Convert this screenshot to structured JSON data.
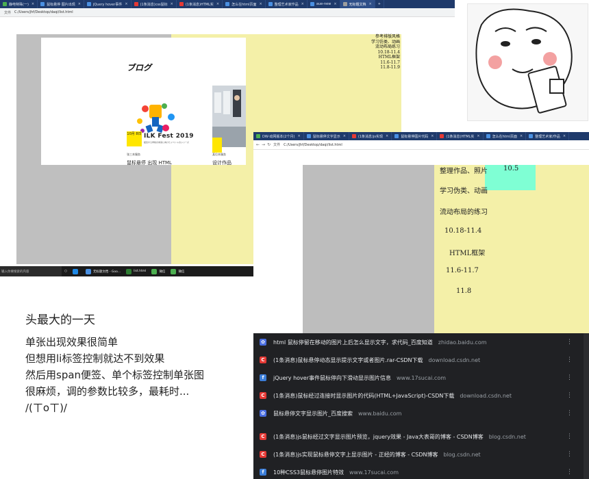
{
  "browser1": {
    "tabs": [
      {
        "label": "静电特殊(一)",
        "color": "#4caf50",
        "active": false
      },
      {
        "label": "鼠标悬停 图片出现",
        "color": "#4a90e2",
        "active": false
      },
      {
        "label": "jQuery hover事件",
        "color": "#4a90e2",
        "active": false
      },
      {
        "label": "(1条消息)css鼠标",
        "color": "#e53935",
        "active": false
      },
      {
        "label": "(1条消息)HTML实",
        "color": "#e53935",
        "active": false
      },
      {
        "label": "怎么在html页面",
        "color": "#4a90e2",
        "active": false
      },
      {
        "label": "整理艺术家作品",
        "color": "#4a90e2",
        "active": false
      },
      {
        "label": "aue-new",
        "color": "#4a90e2",
        "active": false
      },
      {
        "label": "无标题文档",
        "color": "#9e9e9e",
        "active": true
      }
    ],
    "address_label": "文件",
    "address": "C:/Users/jhf/Desktop/daqi/list.html",
    "nav_items": [
      "参考排版风格",
      "学习仿类、动画",
      "流动布局练习",
      "10.18-11.4",
      "HTML框架",
      "11.6-11.7",
      "11.8-11.9"
    ],
    "blog_title": "ブログ",
    "fest_date": "10月 8日",
    "fest_title": "ILK Fest 2019",
    "fest_sub": "結合する学校の未来に向けたイベントのシリーズ",
    "card1_caption": "张三本服务",
    "card1_title": "鼠标悬停 出现 HTML",
    "card2_caption": "某位本服务",
    "card2_title": "设计作品"
  },
  "taskbar": {
    "search_placeholder": "输入你要搜索的内容",
    "items": [
      {
        "label": "无标题文档 - Goo...",
        "color": "#4a90e2"
      },
      {
        "label": "list.html",
        "color": "#2e7d32"
      },
      {
        "label": "微信",
        "color": "#4caf50"
      },
      {
        "label": "微信",
        "color": "#4caf50"
      }
    ]
  },
  "browser2": {
    "tabs": [
      {
        "label": "DW-动网版本(2个月)",
        "color": "#4caf50"
      },
      {
        "label": "鼠标悬停文字显示",
        "color": "#4a90e2"
      },
      {
        "label": "(1条消息)js实现",
        "color": "#e53935"
      },
      {
        "label": "鼠标悬停图片代码",
        "color": "#4a90e2"
      },
      {
        "label": "(1条消息)HTML实",
        "color": "#e53935"
      },
      {
        "label": "怎么在html页面",
        "color": "#4a90e2"
      },
      {
        "label": "整理艺术家/作品",
        "color": "#4a90e2"
      }
    ],
    "address_label": "文件",
    "address": "C:/Users/jhf/Desktop/daqi/list.html",
    "nav_items": [
      "整理作品、照片",
      "10.5",
      "学习伪类、动画",
      "流动布局的练习",
      "10.18-11.4",
      "HTML框架",
      "11.6-11.7",
      "11.8"
    ]
  },
  "suggestions": [
    {
      "title": "html 鼠标停留在移动的图片上后怎么显示文字，求代码_百度知道",
      "domain": "zhidao.baidu.com",
      "icon": "paw",
      "color": "#4a6ee0"
    },
    {
      "title": "(1条消息)鼠标悬停动态显示提示文字或者图片.rar-CSDN下载",
      "domain": "download.csdn.net",
      "icon": "C",
      "color": "#e53935"
    },
    {
      "title": "jQuery hover事件鼠标停向下滑动显示图片信息",
      "domain": "www.17sucai.com",
      "icon": "f",
      "color": "#3b7dd8"
    },
    {
      "title": "(1条消息)鼠标经过连接时显示图片的代码(HTML+JavaScript)-CSDN下载",
      "domain": "download.csdn.net",
      "icon": "C",
      "color": "#e53935"
    },
    {
      "title": "鼠标悬停文字显示图片_百度搜索",
      "domain": "www.baidu.com",
      "icon": "paw",
      "color": "#4a6ee0"
    },
    {
      "title": "(1条消息)js鼠标经过文字显示图片预览，jquery效果 - Java大表哥的博客 - CSDN博客",
      "domain": "blog.csdn.net",
      "icon": "C",
      "color": "#e53935"
    },
    {
      "title": "(1条消息)js实现鼠标悬停文字上显示图片 - 正经的博客 - CSDN博客",
      "domain": "blog.csdn.net",
      "icon": "C",
      "color": "#e53935"
    },
    {
      "title": "10种CSS3鼠标悬停图片特效",
      "domain": "www.17sucai.com",
      "icon": "f",
      "color": "#3b7dd8"
    }
  ],
  "caption": {
    "title": "头最大的一天",
    "lines": [
      "单张出现效果很简单",
      "但想用li标签控制就达不到效果",
      "然后用span便签、单个标签控制单张图",
      "很麻烦，调的参数比较多，最耗时...",
      "/(ㄒoㄒ)/"
    ]
  }
}
